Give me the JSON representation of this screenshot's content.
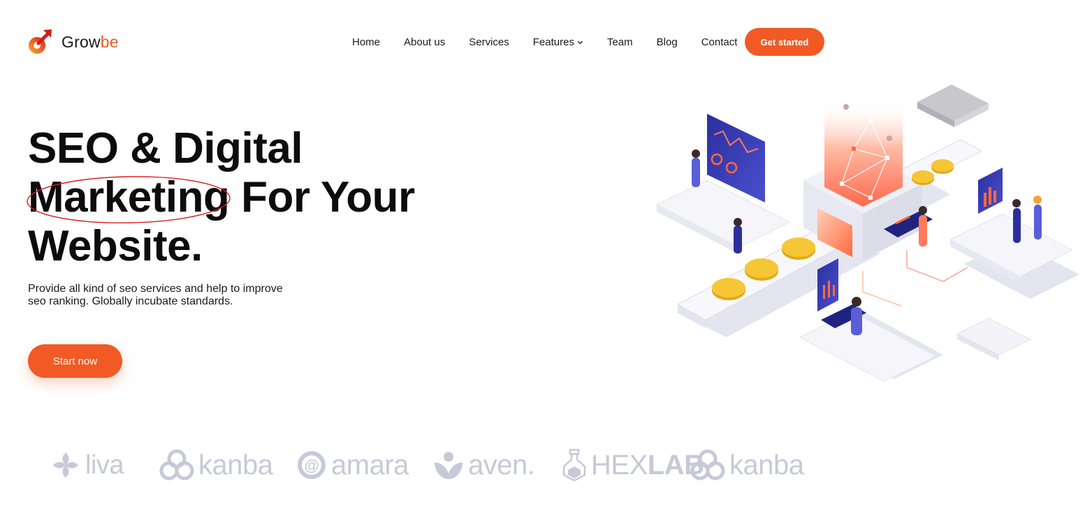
{
  "brand": {
    "name_primary": "Grow",
    "name_accent": "be",
    "accent_color": "#f15a24"
  },
  "nav": {
    "items": [
      {
        "label": "Home"
      },
      {
        "label": "About us"
      },
      {
        "label": "Services"
      },
      {
        "label": "Features",
        "has_dropdown": true
      },
      {
        "label": "Team"
      },
      {
        "label": "Blog"
      },
      {
        "label": "Contact"
      }
    ],
    "cta_label": "Get started"
  },
  "hero": {
    "title_line1": "SEO & Digital",
    "title_line2_highlight": "Marketing",
    "title_line2_rest": " For Your",
    "title_line3": "Website.",
    "description_line1": "Provide all kind of seo services and help to improve",
    "description_line2": "seo ranking. Globally incubate standards.",
    "cta_label": "Start now",
    "illustration_icon": "isometric-seo-platform-illustration"
  },
  "logos": [
    {
      "icon": "liva-logo-icon",
      "text": "liva"
    },
    {
      "icon": "kanba-logo-icon",
      "text": "kanba"
    },
    {
      "icon": "amara-logo-icon",
      "text": "amara"
    },
    {
      "icon": "aven-logo-icon",
      "text": "aven."
    },
    {
      "icon": "hexlab-logo-icon",
      "text_light": "HEX",
      "text_bold": "LAB"
    },
    {
      "icon": "kanba-logo-icon",
      "text": "kanba"
    }
  ],
  "colors": {
    "primary": "#f15a24",
    "text": "#111111",
    "logo_gray": "#c7c9d8",
    "circle_mark": "#d81b1b"
  }
}
